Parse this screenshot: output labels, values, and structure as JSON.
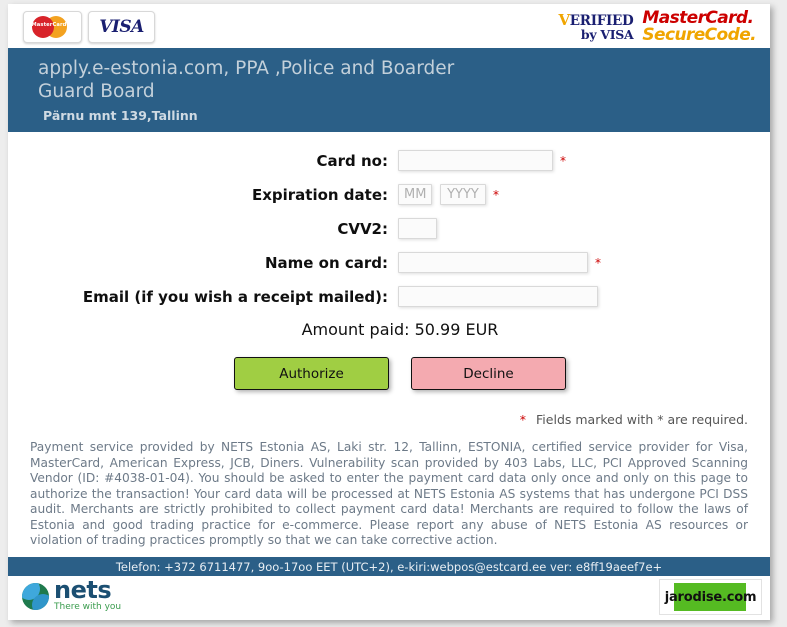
{
  "brand_logos": {
    "mastercard_label": "MasterCard",
    "visa_label": "VISA",
    "verified_by_visa": {
      "line1_v": "V",
      "line1_rest": "ERIFIED",
      "line2": "by VISA"
    },
    "mastercard_securecode": {
      "line1": "MasterCard.",
      "line2": "SecureCode."
    }
  },
  "header": {
    "merchant_title": "apply.e-estonia.com, PPA ,Police and Boarder Guard Board",
    "merchant_address": "Pärnu mnt 139,Tallinn"
  },
  "form": {
    "fields": [
      {
        "label": "Card no:",
        "value": "",
        "placeholder": "",
        "required": true,
        "required_mark": "*"
      },
      {
        "label": "Expiration date:",
        "month_value": "",
        "month_placeholder": "MM",
        "year_value": "",
        "year_placeholder": "YYYY",
        "required": true,
        "required_mark": "*"
      },
      {
        "label": "CVV2:",
        "value": "",
        "placeholder": "",
        "required": false,
        "required_mark": ""
      },
      {
        "label": "Name on card:",
        "value": "",
        "placeholder": "",
        "required": true,
        "required_mark": "*"
      },
      {
        "label": "Email (if you wish a receipt mailed):",
        "value": "",
        "placeholder": "",
        "required": false,
        "required_mark": ""
      }
    ],
    "amount_text": "Amount paid: 50.99 EUR",
    "authorize_label": "Authorize",
    "decline_label": "Decline",
    "required_note_star": "*",
    "required_note": "Fields marked with * are required."
  },
  "legal_text": "Payment service provided by NETS Estonia AS, Laki str. 12, Tallinn, ESTONIA, certified service provider for Visa, MasterCard, American Express, JCB, Diners. Vulnerability scan provided by 403 Labs, LLC, PCI Approved Scanning Vendor (ID: #4038-01-04). You should be asked to enter the payment card data only once and only on this page to authorize the transaction! Your card data will be processed at NETS Estonia AS systems that has undergone PCI DSS audit. Merchants are strictly prohibited to collect payment card data! Merchants are required to follow the laws of Estonia and good trading practice for e-commerce. Please report any abuse of NETS Estonia AS resources or violation of trading practices promptly so that we can take corrective action.",
  "footer": {
    "contact_line": "Telefon: +372 6711477, 9oo-17oo EET (UTC+2), e-kiri:webpos@estcard.ee ver: e8ff19aeef7e+",
    "nets_name": "nets",
    "nets_tagline": "There with you",
    "watermark_text": "jarodise.com"
  },
  "colors": {
    "header_blue": "#2b5f87",
    "authorize_green": "#a0ce43",
    "decline_pink": "#f4aab0",
    "required_red": "#cc0000"
  }
}
